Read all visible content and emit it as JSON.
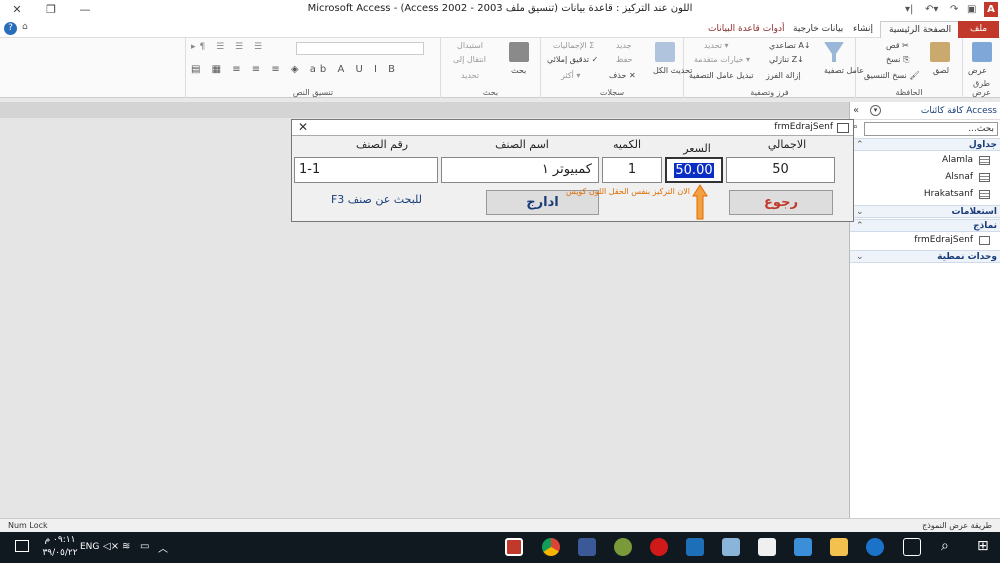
{
  "app": {
    "title": "اللون عند التركيز : قاعدة بيانات (تنسيق ملف Access 2002 - 2003) - Microsoft Access"
  },
  "tabs": [
    "ملف",
    "الصفحة الرئيسية",
    "إنشاء",
    "بيانات خارجية",
    "أدوات قاعدة البيانات"
  ],
  "ribbon": {
    "groups": [
      "طرق عرض",
      "الحافظة",
      "فرز وتصفية",
      "سجلات",
      "بحث",
      "تنسيق النص"
    ],
    "views": {
      "view": "عرض"
    },
    "clipboard": {
      "paste": "لصق",
      "cut": "قص",
      "copy": "نسخ",
      "format_painter": "نسخ التنسيق"
    },
    "sort_filter": {
      "filter": "عامل تصفية",
      "ascending": "تصاعدي",
      "descending": "تنازلي",
      "remove_sort": "إزالة الفرز",
      "selection": "تحديد",
      "advanced": "خيارات متقدمة",
      "toggle_filter": "تبديل عامل التصفية"
    },
    "records": {
      "refresh": "تحديث الكل",
      "new": "جديد",
      "save": "حفظ",
      "delete": "حذف",
      "totals": "الإجماليات",
      "spelling": "تدقيق إملائي",
      "more": "أكثر"
    },
    "find": {
      "find": "بحث",
      "replace": "استبدال",
      "goto": "انتقال إلى",
      "select": "تحديد"
    }
  },
  "nav": {
    "title": "كافة كائنات Access",
    "search_placeholder": "بحث...",
    "sections": {
      "tables": {
        "label": "جداول",
        "items": [
          "Alamla",
          "Alsnaf",
          "Hrakatsanf"
        ]
      },
      "queries": {
        "label": "استعلامات"
      },
      "forms": {
        "label": "نماذج",
        "items": [
          "frmEdrajSenf"
        ]
      },
      "modules": {
        "label": "وحدات نمطية"
      }
    }
  },
  "form": {
    "caption": "frmEdrajSenf",
    "labels": {
      "total": "الاجمالي",
      "price": "السعر",
      "qty": "الكميه",
      "item_name": "اسم الصنف",
      "item_no": "رقم الصنف"
    },
    "values": {
      "total": "50",
      "price": "50.00",
      "qty": "1",
      "item_name": "كمبيوتر ١",
      "item_no": "1-1"
    },
    "back_button": "رجوع",
    "insert_button": "ادارج",
    "note": "الان التركيز بنفس الحقل اللون كويس",
    "search_hint": "للبحث عن صنف F3"
  },
  "status": {
    "left": "Num Lock",
    "right": "طريقة عرض النموذج"
  },
  "taskbar": {
    "time": "٠٩:١١ م",
    "date": "٣٩/٠٥/٢٢",
    "lang": "ENG"
  },
  "colors": {
    "file_tab": "#c0392b",
    "selection": "#0a2ec4",
    "accent_red": "#c0392b",
    "note_orange": "#e06c00",
    "nav_section": "#1a3d7a"
  }
}
